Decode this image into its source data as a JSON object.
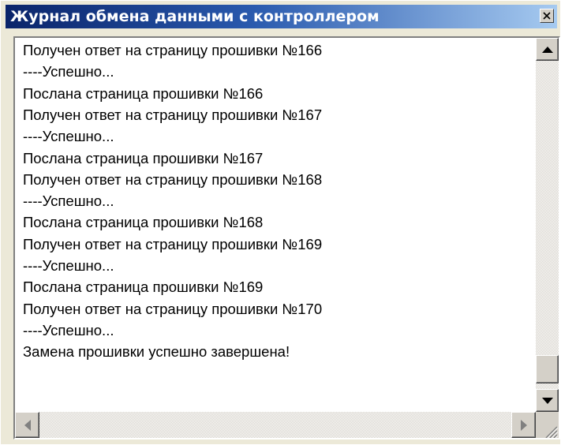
{
  "window": {
    "title": "Журнал обмена данными с контроллером"
  },
  "log": {
    "lines": [
      "Получен ответ на страницу прошивки №166",
      "----Успешно...",
      "Послана страница прошивки №166",
      "Получен ответ на страницу прошивки №167",
      "----Успешно...",
      "Послана страница прошивки №167",
      "Получен ответ на страницу прошивки №168",
      "----Успешно...",
      "Послана страница прошивки №168",
      "Получен ответ на страницу прошивки №169",
      "----Успешно...",
      "Послана страница прошивки №169",
      "Получен ответ на страницу прошивки №170",
      "----Успешно...",
      "Замена прошивки успешно завершена!"
    ]
  },
  "icons": {
    "close": "close-icon",
    "scroll_up": "arrow-up-icon",
    "scroll_down": "arrow-down-icon",
    "scroll_left": "arrow-left-icon",
    "scroll_right": "arrow-right-icon"
  },
  "colors": {
    "title_gradient_start": "#0a246a",
    "title_gradient_end": "#a6caf0",
    "face": "#d4d0c8"
  }
}
